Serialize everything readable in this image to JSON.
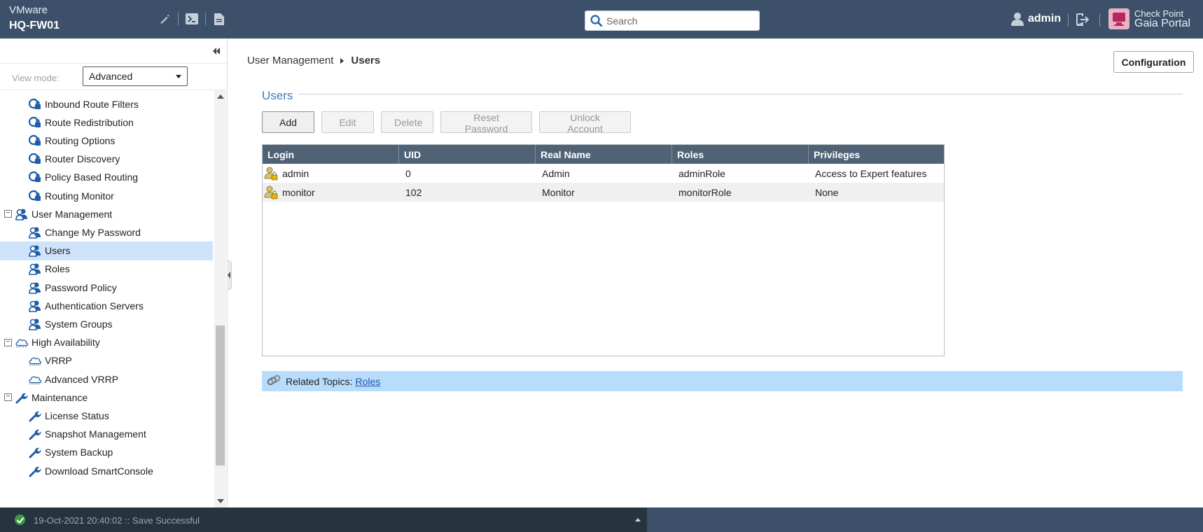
{
  "header": {
    "app_name": "VMware",
    "hostname": "HQ-FW01",
    "search_placeholder": "Search",
    "username": "admin",
    "brand_line1": "Check Point",
    "brand_line2": "Gaia Portal",
    "colors": {
      "topbar": "#3c5169",
      "accent": "#3c7bb8"
    }
  },
  "sidebar": {
    "view_mode_label": "View mode:",
    "view_mode_value": "Advanced",
    "items": [
      {
        "label": "Inbound Route Filters",
        "type": "child",
        "icon": "routing-lock-icon"
      },
      {
        "label": "Route Redistribution",
        "type": "child",
        "icon": "routing-lock-icon"
      },
      {
        "label": "Routing Options",
        "type": "child",
        "icon": "routing-lock-icon"
      },
      {
        "label": "Router Discovery",
        "type": "child",
        "icon": "routing-lock-icon"
      },
      {
        "label": "Policy Based Routing",
        "type": "child",
        "icon": "routing-lock-icon"
      },
      {
        "label": "Routing Monitor",
        "type": "child",
        "icon": "routing-lock-icon"
      },
      {
        "label": "User Management",
        "type": "parent",
        "icon": "users-icon"
      },
      {
        "label": "Change My Password",
        "type": "child",
        "icon": "users-icon"
      },
      {
        "label": "Users",
        "type": "child",
        "icon": "users-icon",
        "selected": true
      },
      {
        "label": "Roles",
        "type": "child",
        "icon": "users-icon"
      },
      {
        "label": "Password Policy",
        "type": "child",
        "icon": "users-icon"
      },
      {
        "label": "Authentication Servers",
        "type": "child",
        "icon": "users-icon"
      },
      {
        "label": "System Groups",
        "type": "child",
        "icon": "users-icon"
      },
      {
        "label": "High Availability",
        "type": "parent",
        "icon": "cloud-icon"
      },
      {
        "label": "VRRP",
        "type": "child",
        "icon": "cloud-icon"
      },
      {
        "label": "Advanced VRRP",
        "type": "child",
        "icon": "cloud-icon"
      },
      {
        "label": "Maintenance",
        "type": "parent",
        "icon": "wrench-icon"
      },
      {
        "label": "License Status",
        "type": "child",
        "icon": "wrench-icon"
      },
      {
        "label": "Snapshot Management",
        "type": "child",
        "icon": "wrench-icon"
      },
      {
        "label": "System Backup",
        "type": "child",
        "icon": "wrench-icon"
      },
      {
        "label": "Download SmartConsole",
        "type": "child",
        "icon": "wrench-icon"
      }
    ]
  },
  "main": {
    "breadcrumb_parent": "User Management",
    "breadcrumb_current": "Users",
    "configuration_button": "Configuration",
    "section_title": "Users",
    "actions": {
      "add": "Add",
      "edit": "Edit",
      "delete": "Delete",
      "reset_password": "Reset Password",
      "unlock_account": "Unlock Account"
    },
    "table": {
      "columns": [
        "Login",
        "UID",
        "Real Name",
        "Roles",
        "Privileges"
      ],
      "rows": [
        [
          "admin",
          "0",
          "Admin",
          "adminRole",
          "Access to Expert features"
        ],
        [
          "monitor",
          "102",
          "Monitor",
          "monitorRole",
          "None"
        ]
      ]
    },
    "related_label": "Related Topics:",
    "related_link": "Roles"
  },
  "status": {
    "message": "19-Oct-2021 20:40:02 :: Save Successful"
  }
}
